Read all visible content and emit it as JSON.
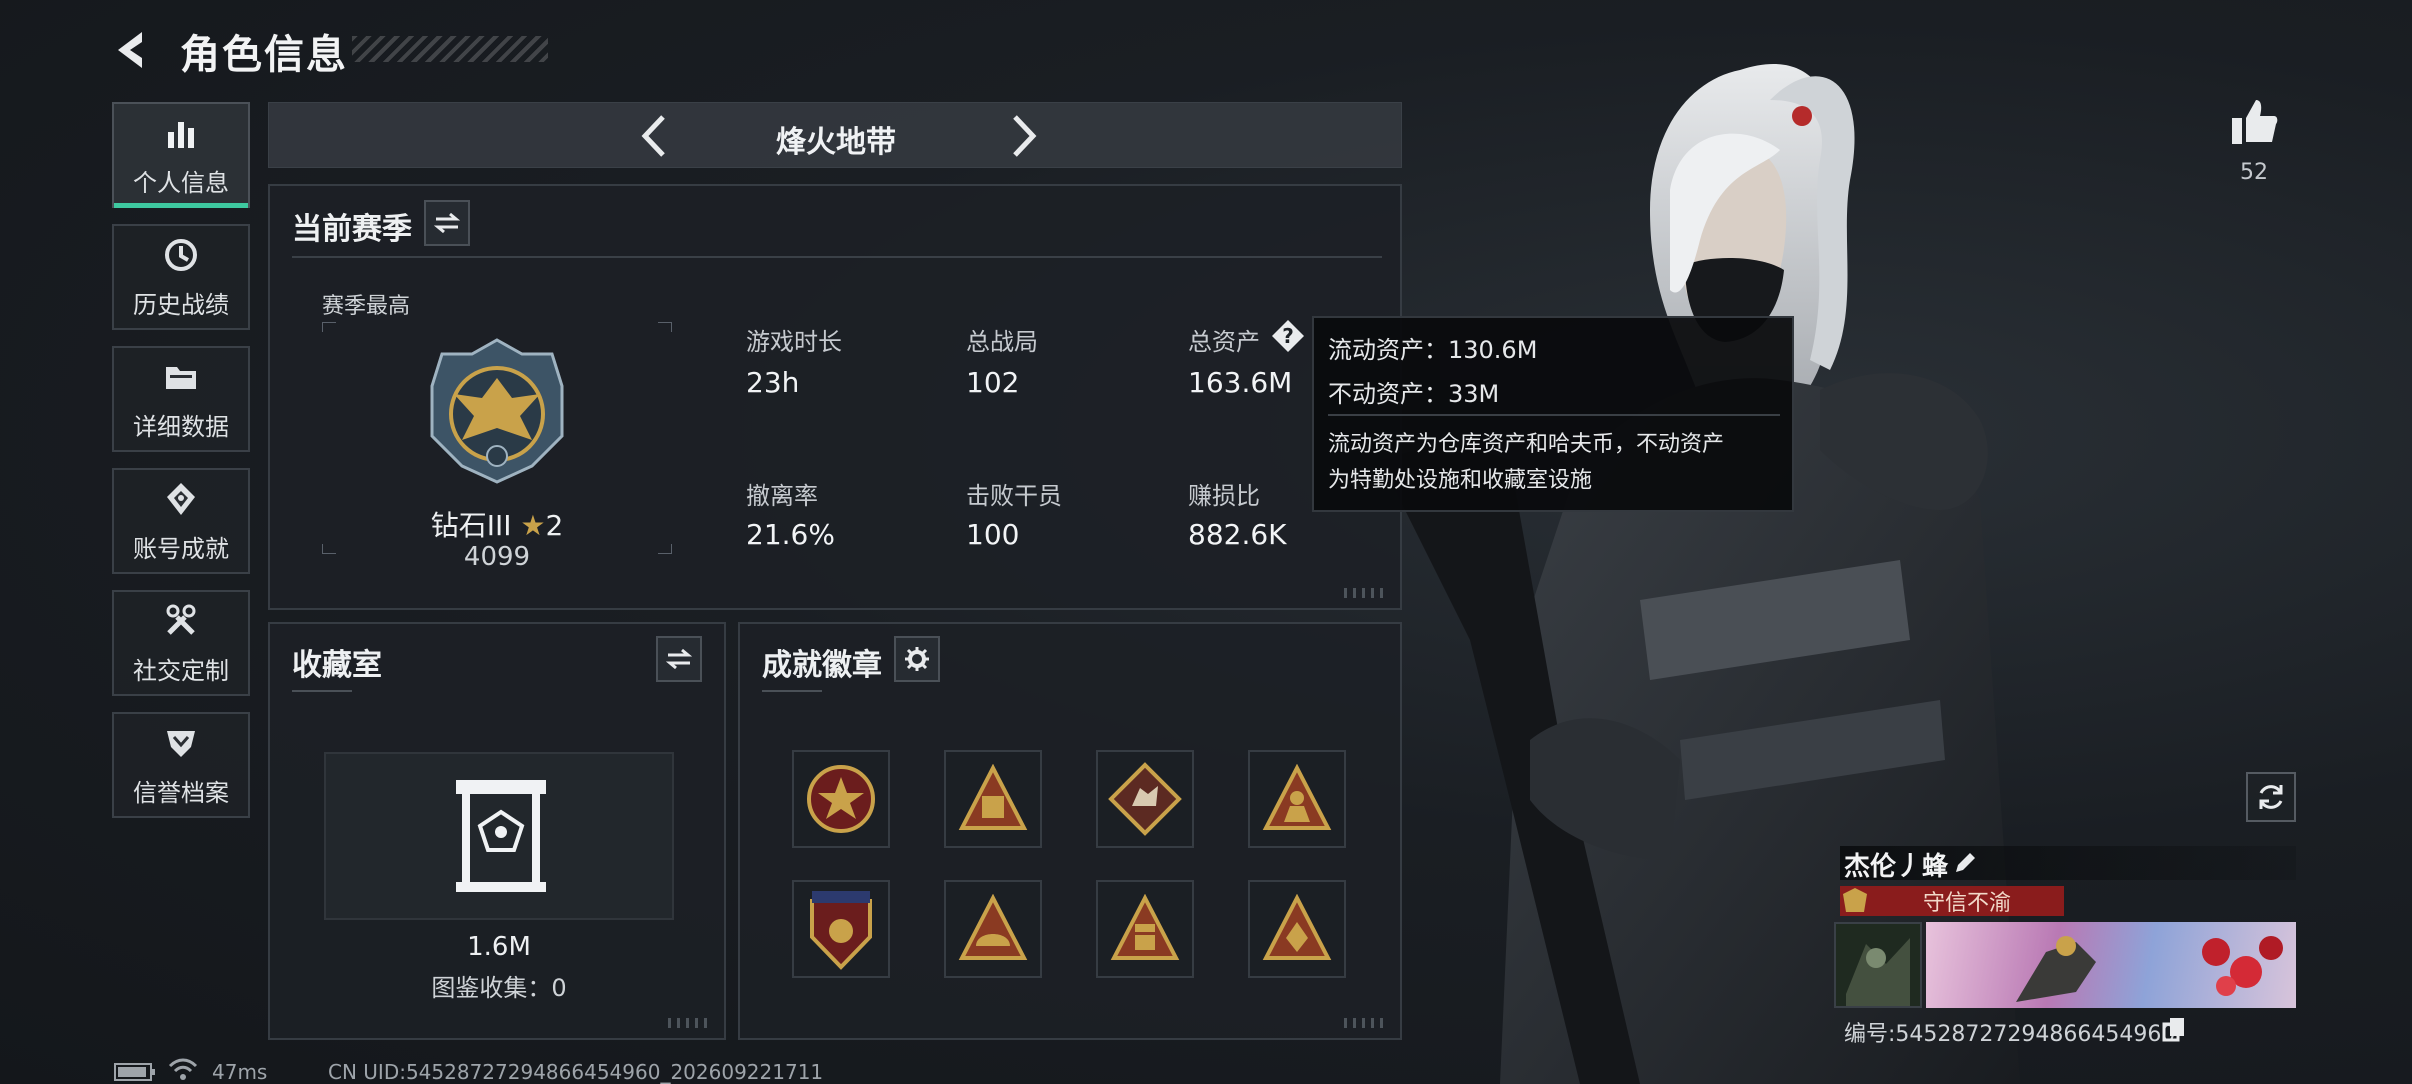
{
  "header": {
    "title": "角色信息"
  },
  "nav": {
    "items": [
      {
        "label": "个人信息",
        "icon": "bar-chart-icon",
        "active": true
      },
      {
        "label": "历史战绩",
        "icon": "clock-history-icon",
        "active": false
      },
      {
        "label": "详细数据",
        "icon": "folder-icon",
        "active": false
      },
      {
        "label": "账号成就",
        "icon": "achievement-diamond-icon",
        "active": false
      },
      {
        "label": "社交定制",
        "icon": "tools-icon",
        "active": false
      },
      {
        "label": "信誉档案",
        "icon": "shield-chevron-icon",
        "active": false
      }
    ]
  },
  "mode": {
    "name": "烽火地带"
  },
  "season": {
    "title": "当前赛季",
    "best_label": "赛季最高",
    "rank_name": "钻石III",
    "rank_stars": "2",
    "rank_score": "4099",
    "stats": [
      {
        "label": "游戏时长",
        "value": "23h"
      },
      {
        "label": "总战局",
        "value": "102"
      },
      {
        "label": "总资产",
        "value": "163.6M"
      },
      {
        "label": "撤离率",
        "value": "21.6%"
      },
      {
        "label": "击败干员",
        "value": "100"
      },
      {
        "label": "赚损比",
        "value": "882.6K"
      }
    ]
  },
  "tooltip": {
    "liquid": "流动资产：130.6M",
    "fixed": "不动资产：33M",
    "desc_line1": "流动资产为仓库资产和哈夫币，不动资产",
    "desc_line2": "为特勤处设施和收藏室设施"
  },
  "collection": {
    "title": "收藏室",
    "value": "1.6M",
    "catalog": "图鉴收集：0"
  },
  "badges": {
    "title": "成就徽章",
    "items": [
      "star-medal-icon",
      "triangle-58-icon",
      "wolf-diamond-icon",
      "soldier-triangle-icon",
      "shield-stars-icon",
      "helmet-triangle-icon",
      "supply-triangle-icon",
      "emblem-triangle-icon"
    ]
  },
  "profile": {
    "likes": "52",
    "name": "杰伦丿蜂",
    "title_tag": "守信不渝",
    "id_text": "编号:54528727294866454960"
  },
  "status": {
    "ping": "47ms",
    "uid": "CN UID:54528727294866454960_202609221711"
  },
  "colors": {
    "accent_green": "#3ec9a0",
    "title_tag_red": "#8a1c1c",
    "gold": "#c9a24a"
  }
}
